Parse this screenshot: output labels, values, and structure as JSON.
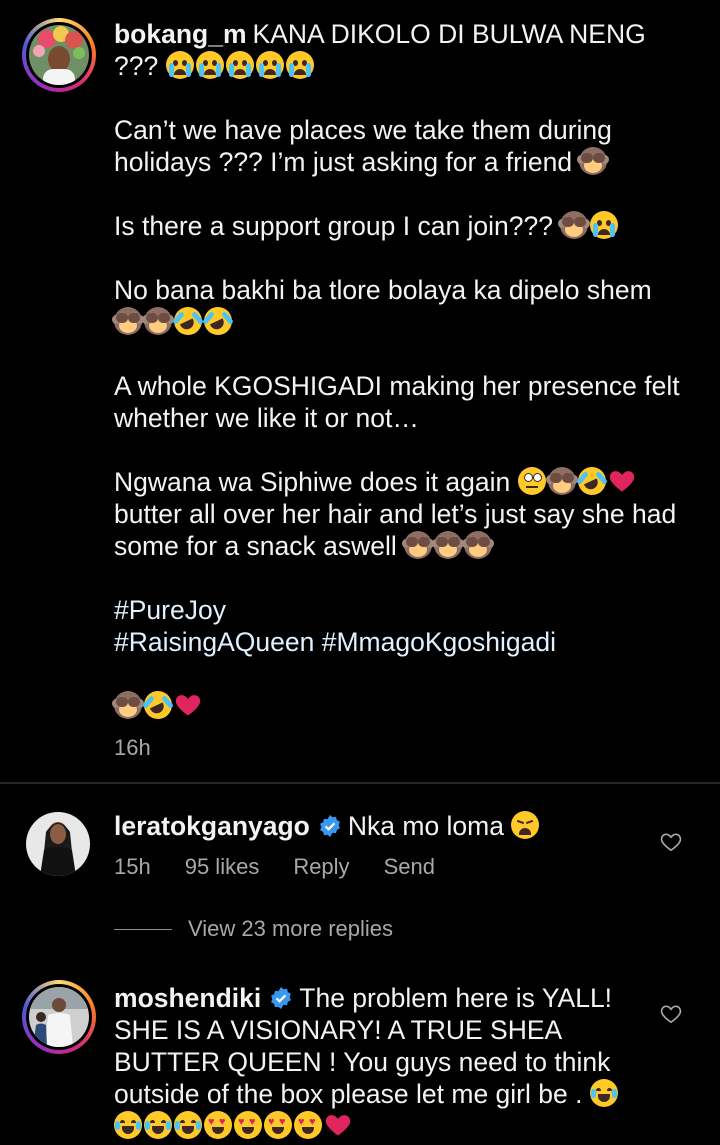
{
  "post": {
    "username": "bokang_m",
    "paragraphs": [
      "KANA DIKOLO DI BULWA NENG ???",
      "Can’t we have places we take them during holidays ??? I’m just asking for a friend",
      "Is there a support group I can join???",
      "No bana bakhi ba tlore bolaya ka dipelo shem",
      "A whole KGOSHIGADI making her presence felt whether we like it or not…",
      "Ngwana wa Siphiwe does it again",
      "butter all over her hair and let’s just say she had some for a snack aswell"
    ],
    "hashtags": [
      "#PureJoy",
      "#RaisingAQueen",
      "#MmagoKgoshigadi"
    ],
    "time": "16h"
  },
  "comments": [
    {
      "username": "leratokganyago",
      "text": "Nka mo loma",
      "time": "15h",
      "likes": "95 likes",
      "reply_label": "Reply",
      "send_label": "Send"
    },
    {
      "username": "moshendiki",
      "text": "The problem here is YALL! SHE IS A VISIONARY! A TRUE SHEA BUTTER QUEEN ! You guys need to think outside of the box please let me girl be ."
    }
  ],
  "view_replies_label": "View 23 more replies",
  "colors": {
    "background": "#000000",
    "text": "#f3f3f3",
    "muted": "#a8a8a8",
    "verified": "#3897f0",
    "heart": "#e0245e"
  },
  "icons": [
    "crying-emoji",
    "monkey-see-no-evil-emoji",
    "rolling-laughing-emoji",
    "red-heart-emoji",
    "eye-roll-emoji",
    "weary-emoji",
    "heart-eyes-emoji",
    "verified-badge-icon",
    "heart-outline-icon"
  ]
}
